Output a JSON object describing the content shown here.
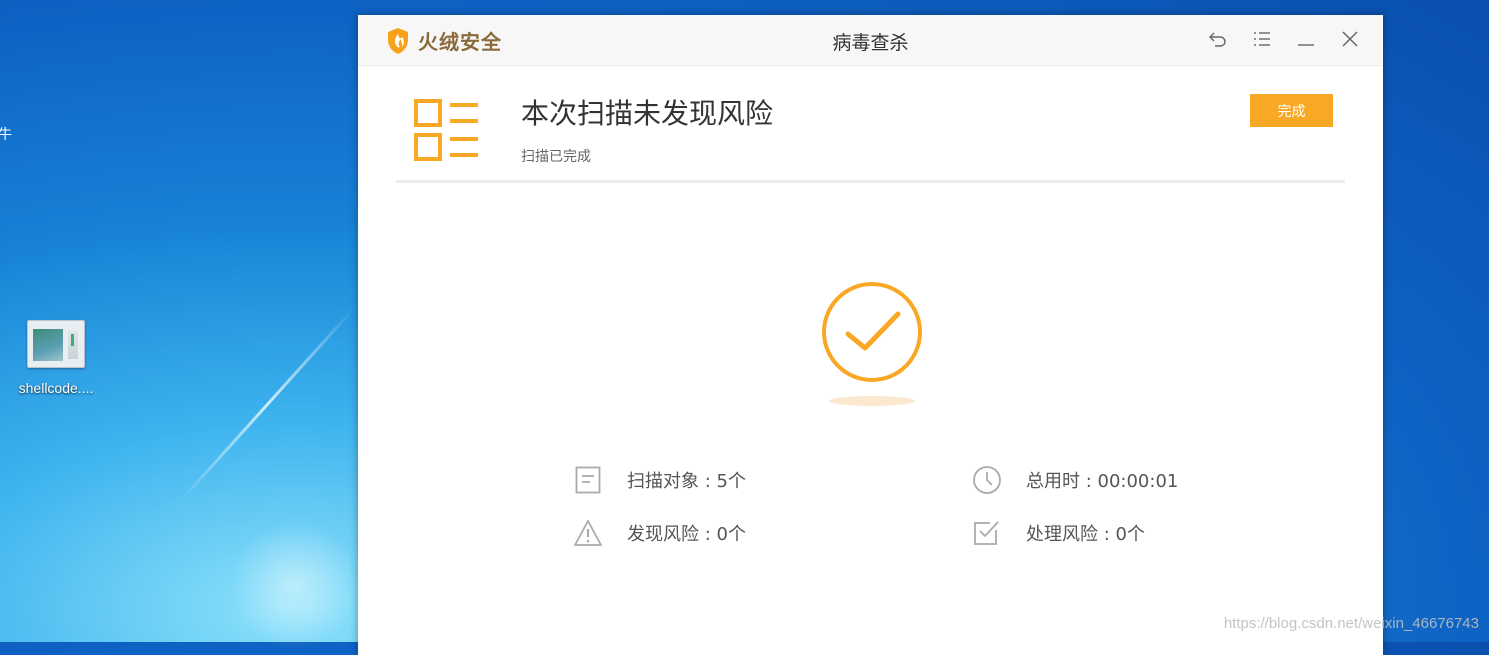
{
  "desktop": {
    "edge_text": "牛",
    "icon_label": "shellcode...."
  },
  "app": {
    "brand": "火绒安全",
    "title": "病毒查杀"
  },
  "result": {
    "headline": "本次扫描未发现风险",
    "status": "扫描已完成",
    "done_button": "完成"
  },
  "stats": {
    "scan_objects": "扫描对象 : 5个",
    "total_time": "总用时 : 00:00:01",
    "risks_found": "发现风险 : 0个",
    "risks_handled": "处理风险 : 0个"
  },
  "watermark": "https://blog.csdn.net/weixin_46676743",
  "colors": {
    "accent": "#f9a825",
    "brand_text": "#8a6a3a"
  }
}
